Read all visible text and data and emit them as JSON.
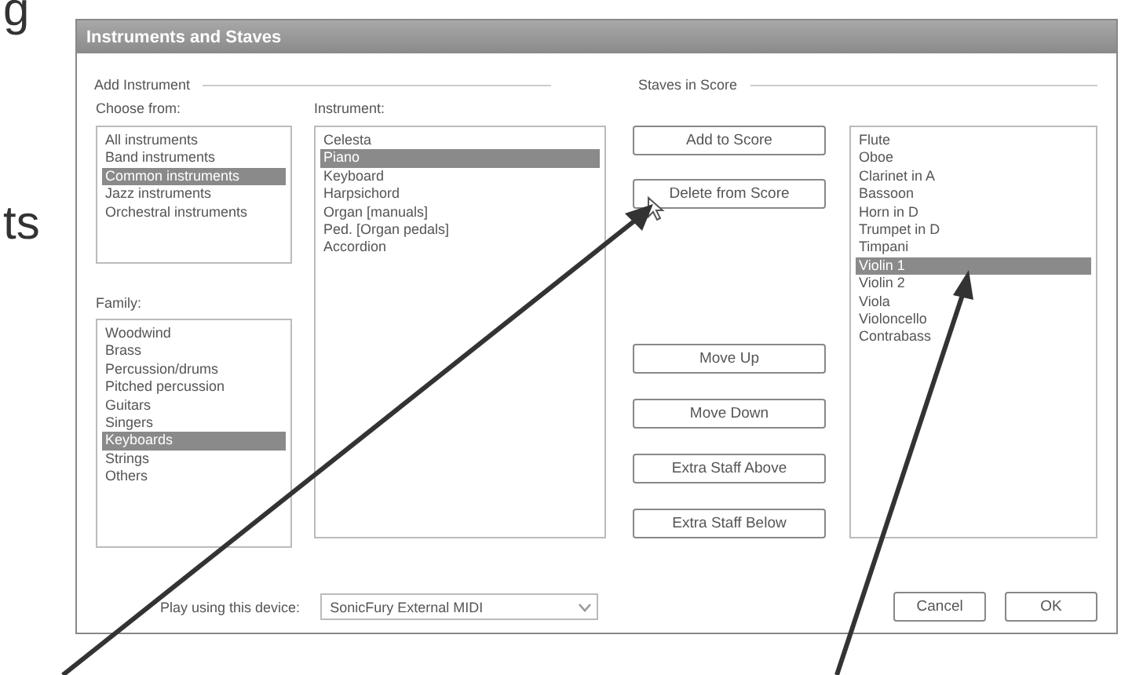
{
  "page_text": [
    "g",
    "ts"
  ],
  "window": {
    "title": "Instruments and Staves"
  },
  "add_instrument": {
    "group_label": "Add Instrument",
    "choose_from": {
      "label": "Choose from:",
      "items": [
        {
          "label": "All instruments",
          "selected": false
        },
        {
          "label": "Band instruments",
          "selected": false
        },
        {
          "label": "Common instruments",
          "selected": true
        },
        {
          "label": "Jazz instruments",
          "selected": false
        },
        {
          "label": "Orchestral instruments",
          "selected": false
        }
      ]
    },
    "family": {
      "label": "Family:",
      "items": [
        {
          "label": "Woodwind",
          "selected": false
        },
        {
          "label": "Brass",
          "selected": false
        },
        {
          "label": "Percussion/drums",
          "selected": false
        },
        {
          "label": "Pitched percussion",
          "selected": false
        },
        {
          "label": "Guitars",
          "selected": false
        },
        {
          "label": "Singers",
          "selected": false
        },
        {
          "label": "Keyboards",
          "selected": true
        },
        {
          "label": "Strings",
          "selected": false
        },
        {
          "label": "Others",
          "selected": false
        }
      ]
    },
    "instrument": {
      "label": "Instrument:",
      "items": [
        {
          "label": "Celesta",
          "selected": false
        },
        {
          "label": "Piano",
          "selected": true
        },
        {
          "label": "Keyboard",
          "selected": false
        },
        {
          "label": "Harpsichord",
          "selected": false
        },
        {
          "label": "Organ [manuals]",
          "selected": false
        },
        {
          "label": "Ped. [Organ pedals]",
          "selected": false
        },
        {
          "label": "Accordion",
          "selected": false
        }
      ]
    }
  },
  "buttons_top": [
    "Add to Score",
    "Delete from Score"
  ],
  "buttons_bottom": [
    "Move Up",
    "Move Down",
    "Extra Staff Above",
    "Extra Staff Below"
  ],
  "staves_in_score": {
    "group_label": "Staves in Score",
    "items": [
      {
        "label": "Flute",
        "selected": false
      },
      {
        "label": "Oboe",
        "selected": false
      },
      {
        "label": "Clarinet in A",
        "selected": false
      },
      {
        "label": "Bassoon",
        "selected": false
      },
      {
        "label": "Horn in D",
        "selected": false
      },
      {
        "label": "Trumpet in D",
        "selected": false
      },
      {
        "label": "Timpani",
        "selected": false
      },
      {
        "label": "Violin 1",
        "selected": true
      },
      {
        "label": "Violin 2",
        "selected": false
      },
      {
        "label": "Viola",
        "selected": false
      },
      {
        "label": "Violoncello",
        "selected": false
      },
      {
        "label": "Contrabass",
        "selected": false
      }
    ]
  },
  "device": {
    "label": "Play using this device:",
    "value": "SonicFury External MIDI"
  },
  "dialog_buttons": [
    "Cancel",
    "OK"
  ]
}
